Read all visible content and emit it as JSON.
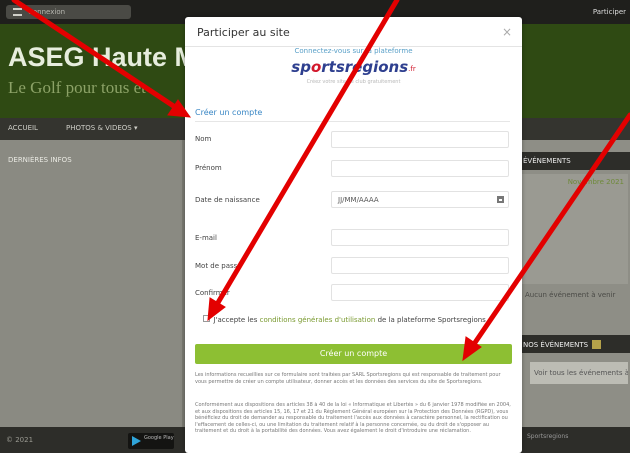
{
  "site": {
    "topbar_pill": "Connexion",
    "topbar_right": "Participer",
    "title": "ASEG Haute M",
    "slogan": "Le Golf pour tous et",
    "nav": [
      "ACCUEIL",
      "PHOTOS & VIDEOS ▾"
    ],
    "left_label": "DERNIÈRES INFOS",
    "right_head": "ÉVÉNEMENTS",
    "right_month": "Novembre 2021",
    "right_text": "Aucun événement à venir",
    "right_head2": "NOS ÉVÉNEMENTS",
    "right_btn": "Voir tous les événements à venir",
    "footer_left": "© 2021",
    "store_label": "Google Play",
    "footer_right": "Sportsregions"
  },
  "modal": {
    "title": "Participer au site",
    "close": "×",
    "connect_text": "Connectez-vous sur la plateforme",
    "logo_a": "sp",
    "logo_o": "o",
    "logo_b": "rtsregions",
    "logo_tail": ".fr",
    "logo_sub": "Créez votre site de club gratuitement",
    "create_link": "Créer un compte",
    "fields": {
      "nom": "Nom",
      "prenom": "Prénom",
      "naissance": "Date de naissance",
      "naissance_placeholder": "JJ/MM/AAAA",
      "email": "E-mail",
      "password": "Mot de passe",
      "confirm": "Confirmer"
    },
    "accept_a": "J'accepte les",
    "accept_cond": "conditions générales d'utilisation",
    "accept_b": "de la plateforme Sportsregions",
    "submit": "Créer un compte",
    "legal_1": "Les informations recueillies sur ce formulaire sont traitées par SARL Sportsregions qui est responsable de traitement pour vous permettre de créer un compte utilisateur, donner accès et les données des services du site de Sportsregions.",
    "legal_2": "Conformément aux dispositions des articles 38 à 40 de la loi « Informatique et Libertés » du 6 janvier 1978 modifiée en 2004, et aux dispositions des articles 15, 16, 17 et 21 du Règlement Général européen sur la Protection des Données (RGPD), vous bénéficiez du droit de demander au responsable du traitement l'accès aux données à caractère personnel, la rectification ou l'effacement de celles-ci, ou une limitation du traitement relatif à la personne concernée, ou du droit de s'opposer au traitement et du droit à la portabilité des données. Vous avez également le droit d'introduire une réclamation."
  },
  "colors": {
    "green_button": "#8dbf33",
    "arrow_red": "#e30000",
    "banner_green": "#2f4a13"
  }
}
